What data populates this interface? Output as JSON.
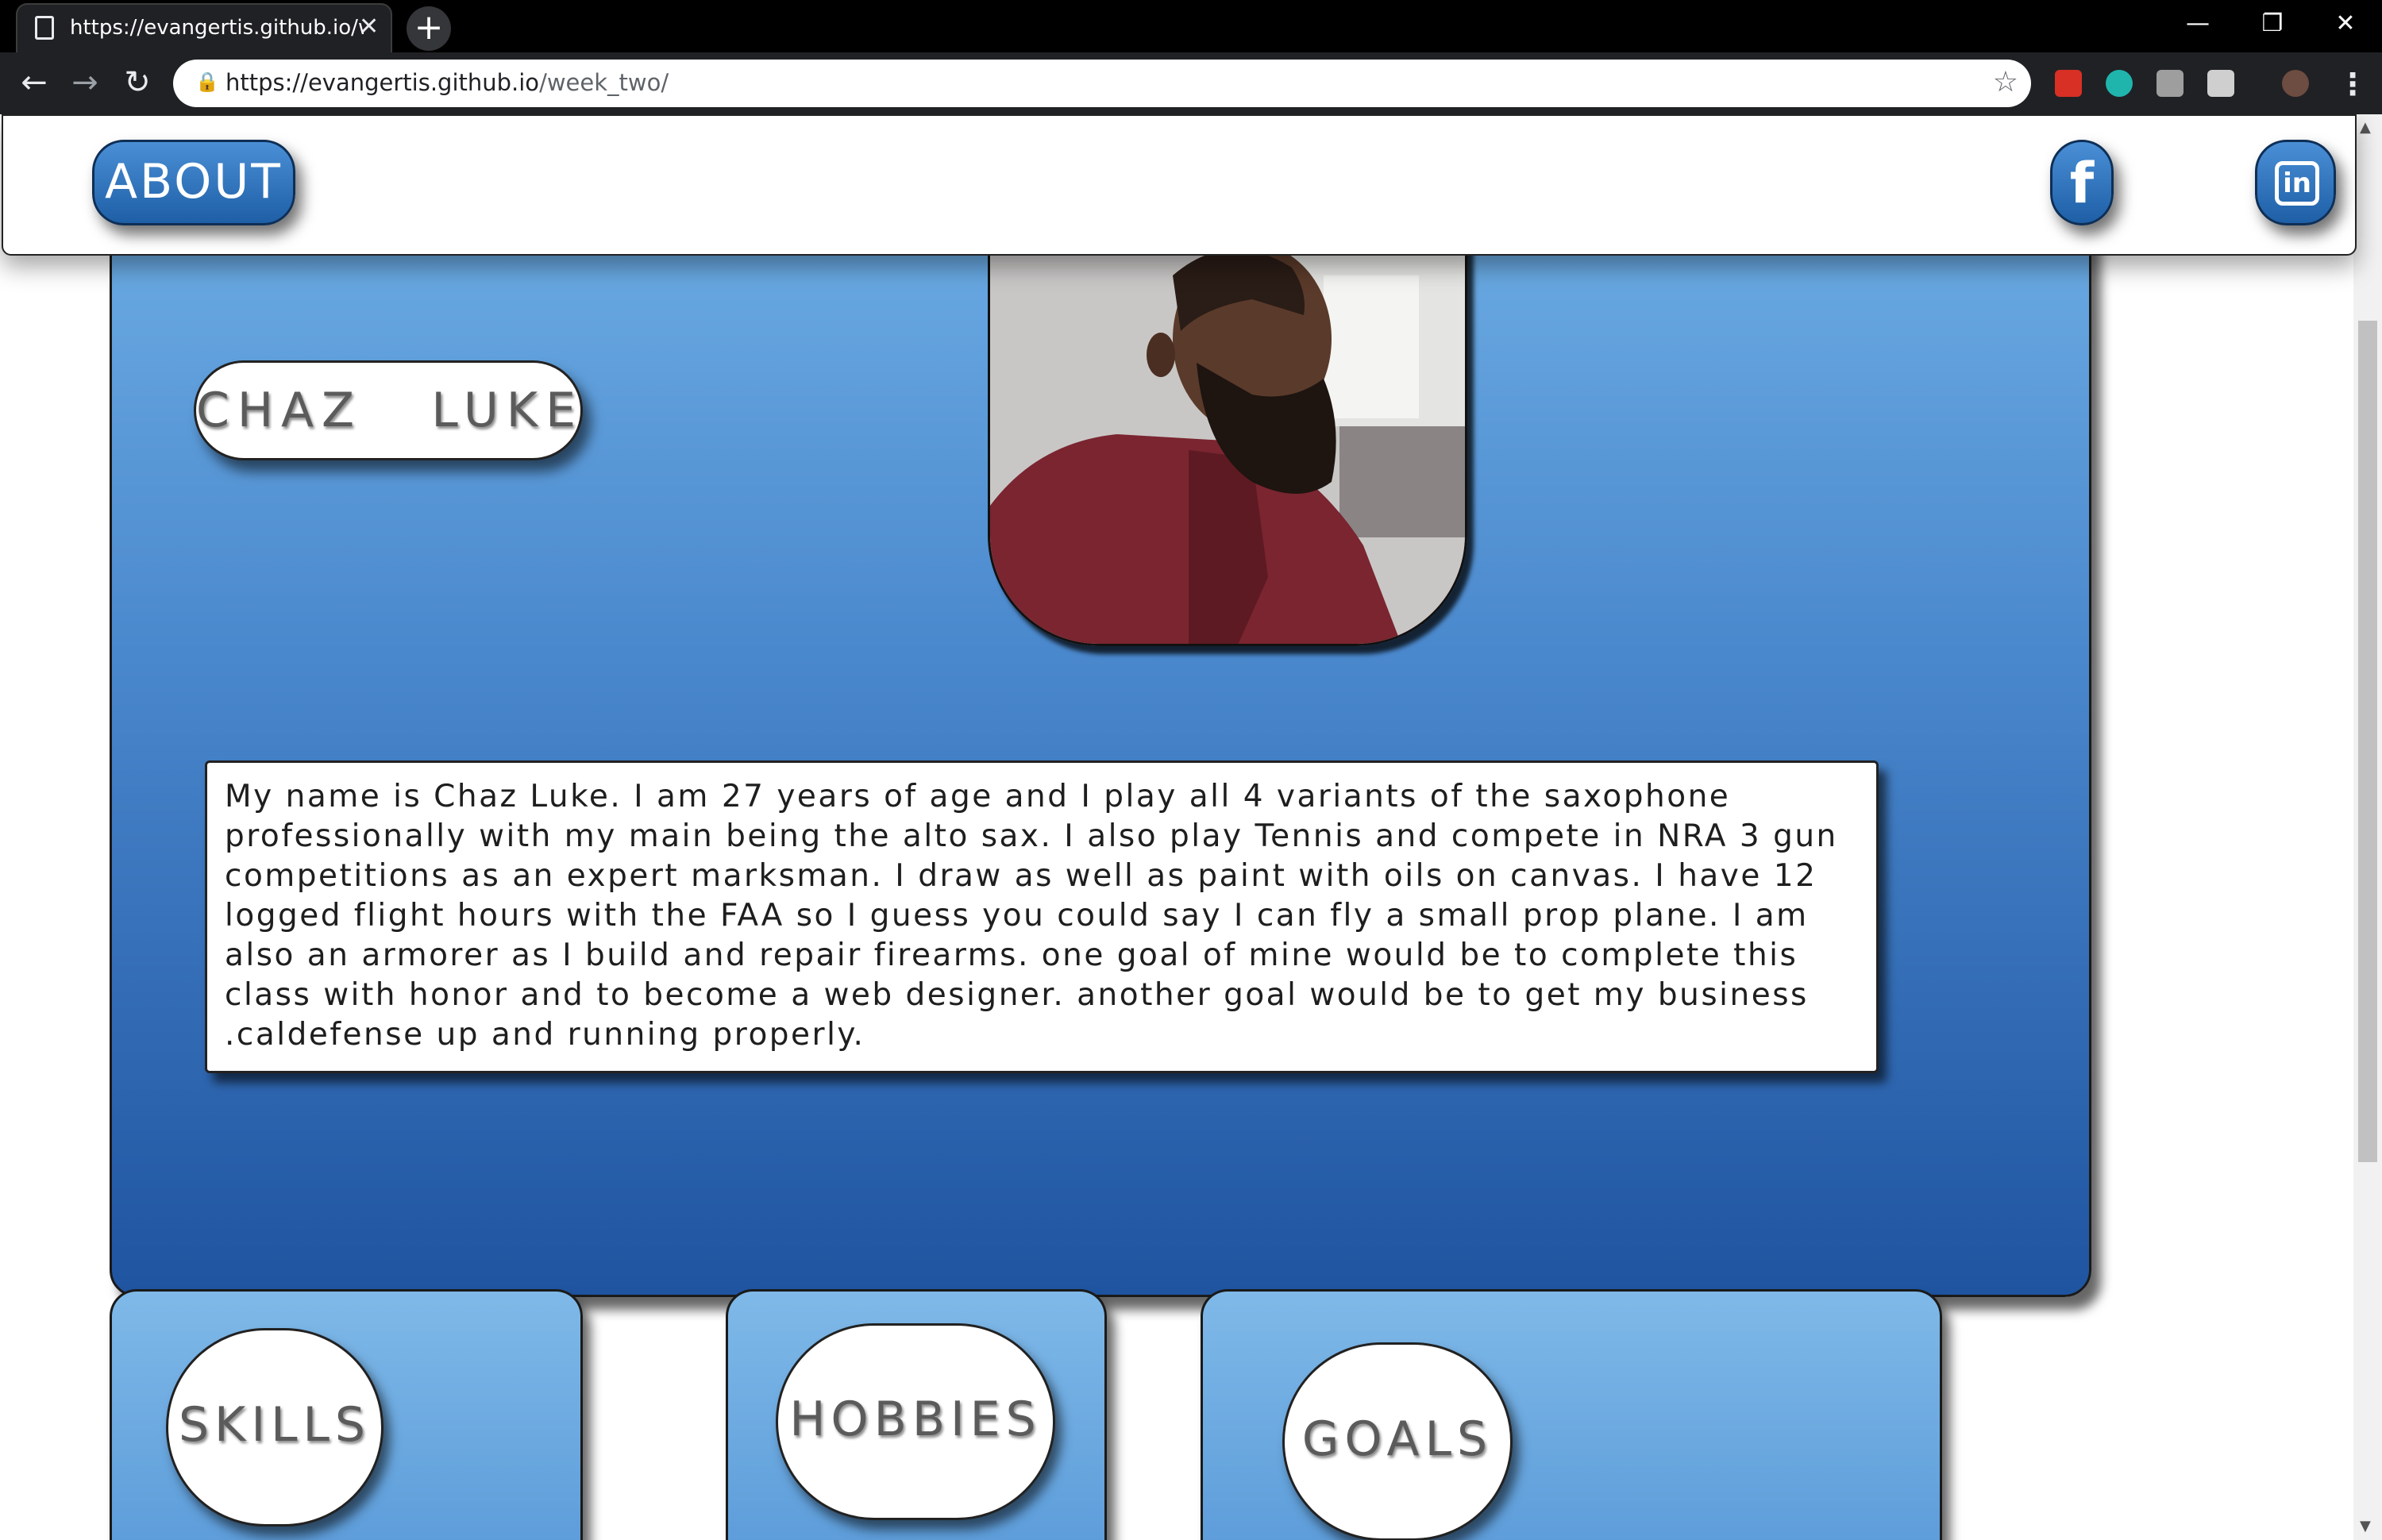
{
  "browser": {
    "tab_title": "https://evangertis.github.io/week_two/",
    "new_tab_label": "+",
    "close_tab_label": "✕",
    "url_host": "https://evangertis.github.io",
    "url_path": "/week_two/",
    "window_controls": [
      "—",
      "❐",
      "✕"
    ]
  },
  "header": {
    "about_label": "ABOUT",
    "facebook_label": "f",
    "linkedin_label": "in"
  },
  "profile": {
    "name": "CHAZ   LUKE",
    "bio": "My name is Chaz Luke. I am 27 years of age and I play all 4 variants of the saxophone professionally with my main being the alto sax. I also play Tennis and compete in NRA 3 gun competitions as an expert marksman. I draw as well as paint with oils on canvas. I have 12 logged flight hours with the FAA so I guess you could say I can fly a small prop plane. I am also an armorer as I build and repair firearms. one goal of mine would be to complete this class with honor and to become a web designer. another goal would be to get my business .caldefense up and running properly."
  },
  "sections": {
    "skills": "SKILLS",
    "hobbies": "HOBBIES",
    "goals": "GOALS"
  },
  "colors": {
    "accent_blue": "#4a88cd",
    "button_dark": "#1e5fa6",
    "text_gray": "#5b5b5b"
  }
}
